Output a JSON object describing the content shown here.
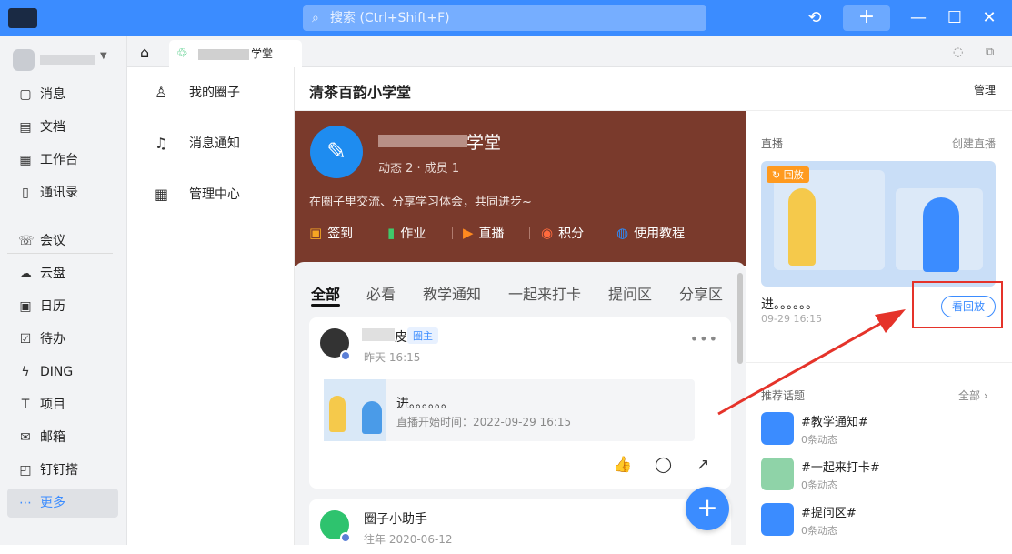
{
  "titlebar": {
    "search_placeholder": "搜索 (Ctrl+Shift+F)",
    "history_icon": "⟲",
    "add_icon": "+",
    "minimize_icon": "—",
    "maximize_icon": "☐",
    "close_icon": "✕",
    "accent": "#3b8cff"
  },
  "sidebar": {
    "items": [
      {
        "label": "消息",
        "icon": "▢"
      },
      {
        "label": "文档",
        "icon": "▤"
      },
      {
        "label": "工作台",
        "icon": "▦"
      },
      {
        "label": "通讯录",
        "icon": "▯"
      },
      {
        "label": "会议",
        "icon": "☏"
      },
      {
        "label": "云盘",
        "icon": "☁"
      },
      {
        "label": "日历",
        "icon": "▣"
      },
      {
        "label": "待办",
        "icon": "☑"
      },
      {
        "label": "DING",
        "icon": "ϟ"
      },
      {
        "label": "项目",
        "icon": "T"
      },
      {
        "label": "邮箱",
        "icon": "✉"
      },
      {
        "label": "钉钉搭",
        "icon": "◰"
      },
      {
        "label": "更多",
        "icon": "⋯"
      }
    ]
  },
  "tabs": {
    "tab_label": "学堂",
    "home_icon": "⌂"
  },
  "midnav": {
    "items": [
      {
        "label": "我的圈子",
        "icon": "♙"
      },
      {
        "label": "消息通知",
        "icon": "♫"
      },
      {
        "label": "管理中心",
        "icon": "▦"
      }
    ]
  },
  "header": {
    "title": "清茶百韵小学堂",
    "manage": "管理"
  },
  "banner": {
    "name": "学堂",
    "meta": "动态 2 · 成员 1",
    "desc": "在圈子里交流、分享学习体会，共同进步~",
    "actions": [
      {
        "label": "签到",
        "icon": "📅",
        "color": "#f5a623"
      },
      {
        "label": "作业",
        "icon": "▮",
        "color": "#3fc96b"
      },
      {
        "label": "直播",
        "icon": "▶",
        "color": "#ff8a1f"
      },
      {
        "label": "积分",
        "icon": "◉",
        "color": "#ff6a3d"
      },
      {
        "label": "使用教程",
        "icon": "◍",
        "color": "#2a8cff"
      }
    ]
  },
  "feed": {
    "tabs": [
      "全部",
      "必看",
      "教学通知",
      "一起来打卡",
      "提问区",
      "分享区"
    ],
    "card1": {
      "name_tail": "皮",
      "tag": "圈主",
      "time": "昨天 16:15",
      "live_title": "进。。。。。。",
      "live_sub": "直播开始时间：2022-09-29 16:15"
    },
    "card2": {
      "name": "圈子小助手",
      "time": "往年 2020-06-12"
    },
    "fab": "+"
  },
  "right": {
    "live_heading": "直播",
    "create_live": "创建直播",
    "replay_badge": "回放",
    "live_title": "进。。。。。。",
    "live_time": "09-29 16:15",
    "replay_button": "看回放",
    "topics_heading": "推荐话题",
    "all_link": "全部 ›",
    "topics": [
      {
        "name": "#教学通知#",
        "count": "0条动态"
      },
      {
        "name": "#一起来打卡#",
        "count": "0条动态"
      },
      {
        "name": "#提问区#",
        "count": "0条动态"
      }
    ]
  }
}
